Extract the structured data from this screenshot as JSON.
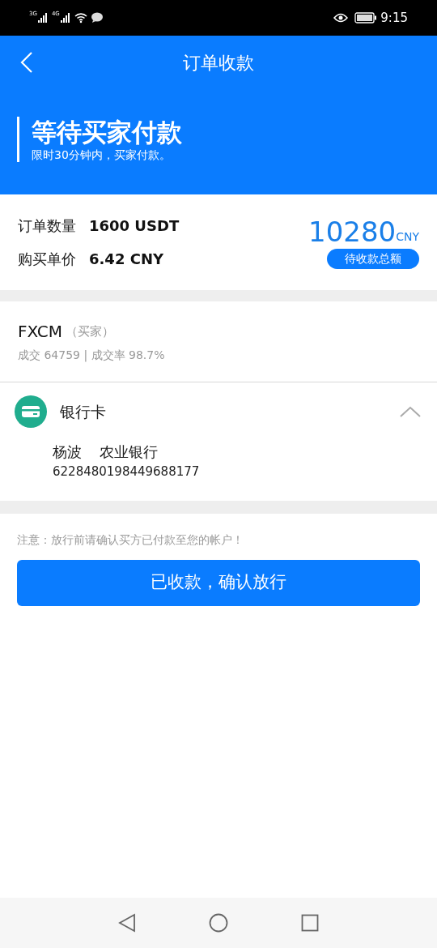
{
  "status_bar": {
    "network_1": "3G",
    "network_2": "4G",
    "time": "9:15"
  },
  "header": {
    "title": "订单收款"
  },
  "banner": {
    "heading": "等待买家付款",
    "subtitle": "限时30分钟内，买家付款。"
  },
  "summary": {
    "rows": [
      {
        "label": "订单数量",
        "value": "1600 USDT"
      },
      {
        "label": "购买单价",
        "value": "6.42 CNY"
      }
    ],
    "total": "10280",
    "total_unit": "CNY",
    "total_label": "待收款总额"
  },
  "buyer": {
    "name": "FXCM",
    "role": "（买家）",
    "stats": "成交 64759 | 成交率 98.7%"
  },
  "payment": {
    "method": "银行卡",
    "expanded": true,
    "holder": "杨波",
    "bank": "农业银行",
    "account": "6228480198449688177"
  },
  "notice": "注意：放行前请确认买方已付款至您的帐户！",
  "confirm_button": "已收款，确认放行"
}
